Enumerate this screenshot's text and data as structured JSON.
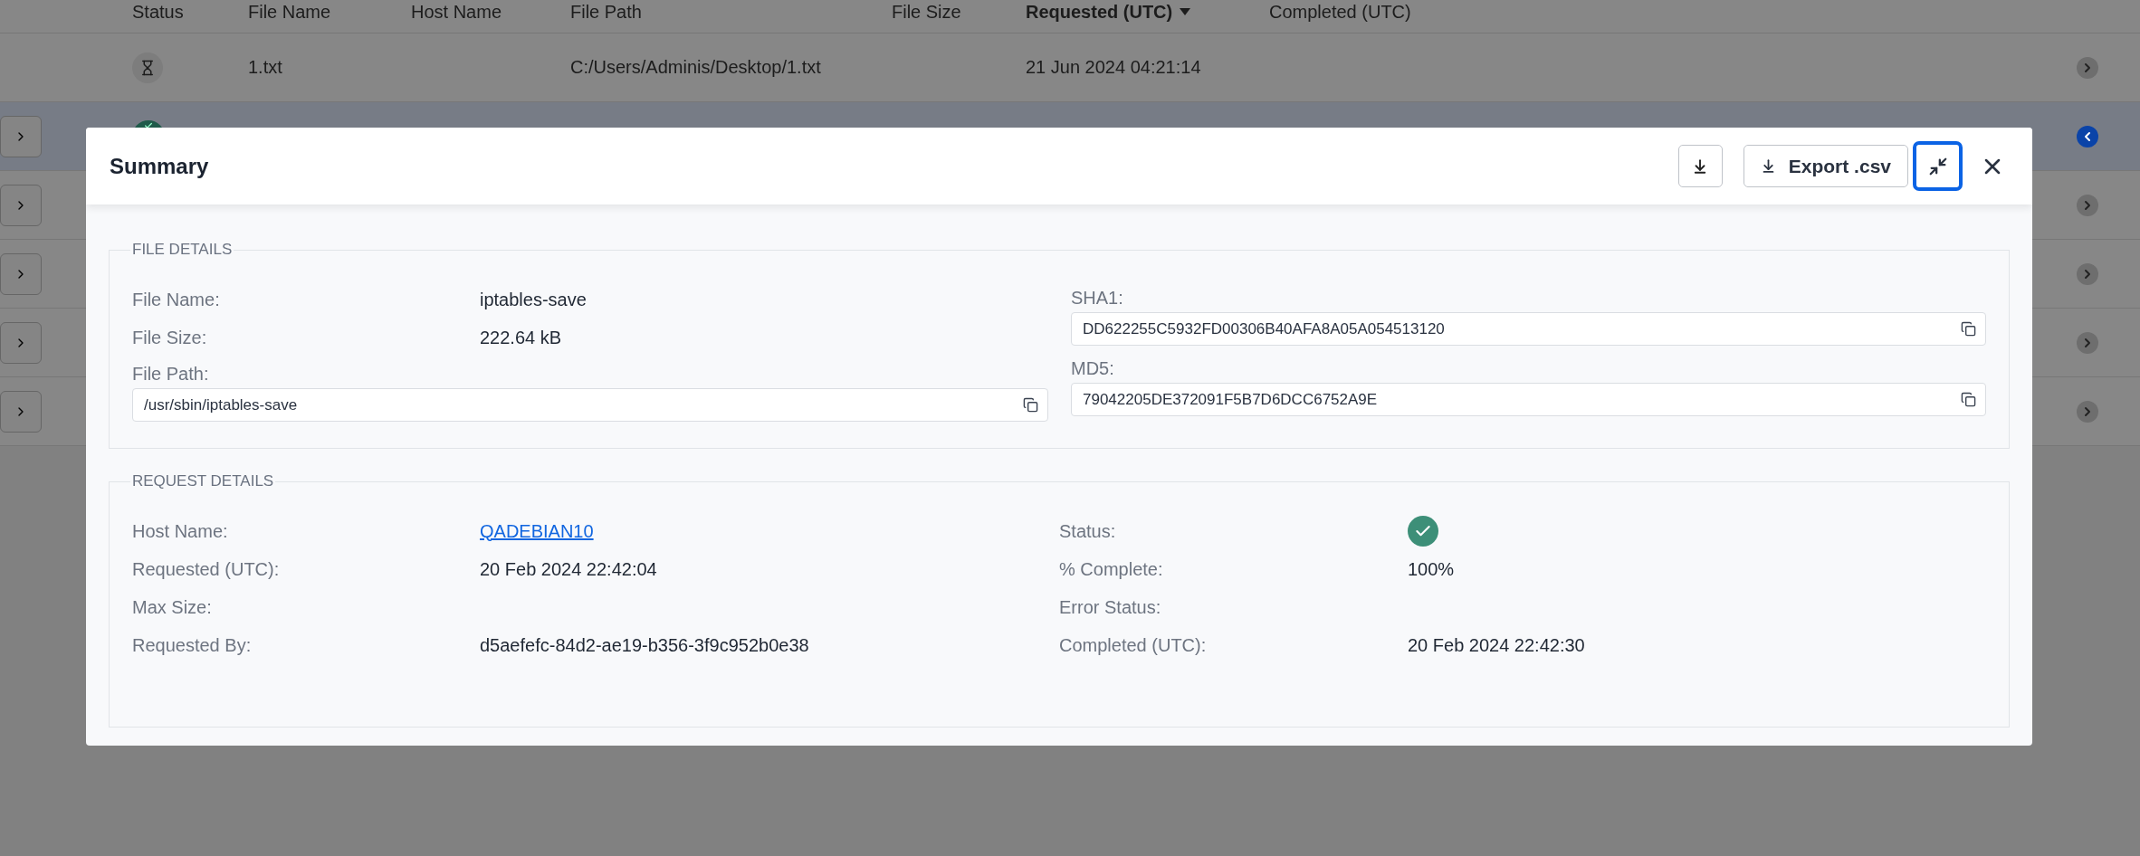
{
  "table": {
    "columns": [
      {
        "label": "Status",
        "sorted": false
      },
      {
        "label": "File Name",
        "sorted": false
      },
      {
        "label": "Host Name",
        "sorted": false
      },
      {
        "label": "File Path",
        "sorted": false
      },
      {
        "label": "File Size",
        "sorted": false
      },
      {
        "label": "Requested (UTC)",
        "sorted": true
      },
      {
        "label": "Completed (UTC)",
        "sorted": false
      }
    ],
    "rows": [
      {
        "selected": false,
        "expandable": false,
        "kind": "pending",
        "file_name": "1.txt",
        "file_path": "C:/Users/Adminis/Desktop/1.txt",
        "requested": "21 Jun 2024 04:21:14"
      },
      {
        "selected": true,
        "expandable": true,
        "kind": "complete"
      },
      {
        "selected": false,
        "expandable": true
      },
      {
        "selected": false,
        "expandable": true
      },
      {
        "selected": false,
        "expandable": true
      },
      {
        "selected": false,
        "expandable": true
      }
    ]
  },
  "modal": {
    "title": "Summary",
    "export_label": "Export .csv",
    "collapse_focused": true,
    "sections": [
      {
        "title": "FILE DETAILS",
        "left": [
          {
            "kind": "text",
            "label": "File Name:",
            "value": "iptables-save"
          },
          {
            "kind": "text",
            "label": "File Size:",
            "value": "222.64 kB"
          },
          {
            "kind": "field",
            "label": "File Path:",
            "value": "/usr/sbin/iptables-save"
          }
        ],
        "right": [
          {
            "kind": "field",
            "label": "SHA1:",
            "value": "DD622255C5932FD00306B40AFA8A05A054513120"
          },
          {
            "kind": "field",
            "label": "MD5:",
            "value": "79042205DE372091F5B7D6DCC6752A9E"
          }
        ]
      },
      {
        "title": "REQUEST DETAILS",
        "left": [
          {
            "kind": "link",
            "label": "Host Name:",
            "value": "QADEBIAN10"
          },
          {
            "kind": "text",
            "label": "Requested (UTC):",
            "value": "20 Feb 2024 22:42:04"
          },
          {
            "kind": "text",
            "label": "Max Size:"
          },
          {
            "kind": "text",
            "label": "Requested By:",
            "value": "d5aefefc-84d2-ae19-b356-3f9c952b0e38"
          }
        ],
        "right": [
          {
            "kind": "status",
            "label": "Status:",
            "done": true
          },
          {
            "kind": "text",
            "label": "% Complete:",
            "value": "100%"
          },
          {
            "kind": "text",
            "label": "Error Status:"
          },
          {
            "kind": "text",
            "label": "Completed (UTC):",
            "value": "20 Feb 2024 22:42:30"
          }
        ]
      }
    ]
  }
}
